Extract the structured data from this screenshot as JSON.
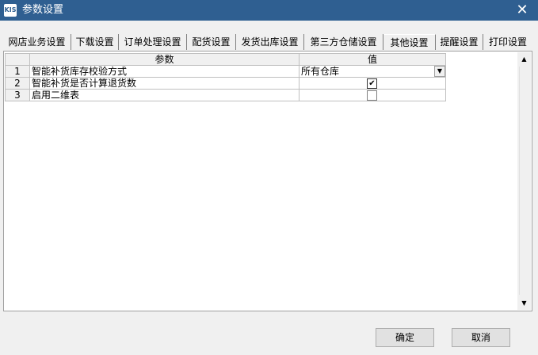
{
  "window": {
    "title": "参数设置",
    "icon": "KIS",
    "close_glyph": "✕"
  },
  "tabs": [
    {
      "label": "网店业务设置"
    },
    {
      "label": "下载设置"
    },
    {
      "label": "订单处理设置"
    },
    {
      "label": "配货设置"
    },
    {
      "label": "发货出库设置"
    },
    {
      "label": "第三方仓储设置"
    },
    {
      "label": "其他设置"
    },
    {
      "label": "提醒设置"
    },
    {
      "label": "打印设置"
    }
  ],
  "active_tab": "其他设置",
  "grid": {
    "headers": {
      "param": "参数",
      "value": "值"
    },
    "rows": [
      {
        "num": "1",
        "name": "智能补货库存校验方式",
        "value": "所有仓库"
      },
      {
        "num": "2",
        "name": "智能补货是否计算退货数",
        "checked": "✔"
      },
      {
        "num": "3",
        "name": "启用二维表",
        "checked": ""
      }
    ]
  },
  "scrollbar": {
    "up_glyph": "▲",
    "down_glyph": "▼"
  },
  "buttons": {
    "ok": "确定",
    "cancel": "取消"
  },
  "combo_arrow_glyph": "▼"
}
